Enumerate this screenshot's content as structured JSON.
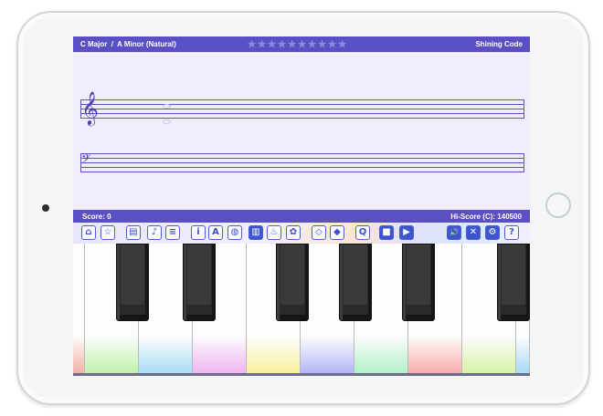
{
  "header": {
    "title": "C Major  /  A Minor (Natural)",
    "brand": "Shining Code",
    "stars": [
      "★",
      "★",
      "★",
      "★",
      "★",
      "★",
      "★",
      "★",
      "★",
      "★"
    ]
  },
  "staff": {
    "treble_clef": "𝄞",
    "bass_clef": "𝄢"
  },
  "status": {
    "score": "Score: 0",
    "hiscore": "Hi-Score (C): 140500"
  },
  "toolbar": {
    "buttons": [
      {
        "name": "home-button",
        "glyph": "⌂"
      },
      {
        "name": "favorite-button",
        "glyph": "☆"
      },
      {
        "name": "book-button",
        "glyph": "▤"
      },
      {
        "name": "scale-button",
        "glyph": "♪"
      },
      {
        "name": "list-button",
        "glyph": "≡"
      },
      {
        "name": "info-button",
        "glyph": "i"
      },
      {
        "name": "note-names-button",
        "glyph": "A"
      },
      {
        "name": "palette-button",
        "glyph": "◍"
      },
      {
        "name": "keyboard-button",
        "glyph": "▥"
      },
      {
        "name": "fire-button",
        "glyph": "♨"
      },
      {
        "name": "animal-button",
        "glyph": "✿"
      },
      {
        "name": "shield-button",
        "glyph": "◇"
      },
      {
        "name": "drop-button",
        "glyph": "◆"
      },
      {
        "name": "quiz-button",
        "glyph": "Q"
      },
      {
        "name": "stop-button",
        "glyph": "■"
      },
      {
        "name": "play-button",
        "glyph": "▶"
      },
      {
        "name": "sound-on-button",
        "glyph": "🔊"
      },
      {
        "name": "mute-button",
        "glyph": "✕"
      },
      {
        "name": "settings-button",
        "glyph": "⚙"
      },
      {
        "name": "help-button",
        "glyph": "?"
      }
    ]
  },
  "colors": {
    "accent": "#5a4fc5",
    "staff_bg": "#efeefa",
    "key_glows": [
      "#f3b0a4",
      "#bff0a8",
      "#a8dcf6",
      "#f0b2f0",
      "#f7f09c",
      "#b3b3f8",
      "#b0f0c8",
      "#f6aaaa",
      "#d6f2a0",
      "#a8d8f6"
    ]
  }
}
